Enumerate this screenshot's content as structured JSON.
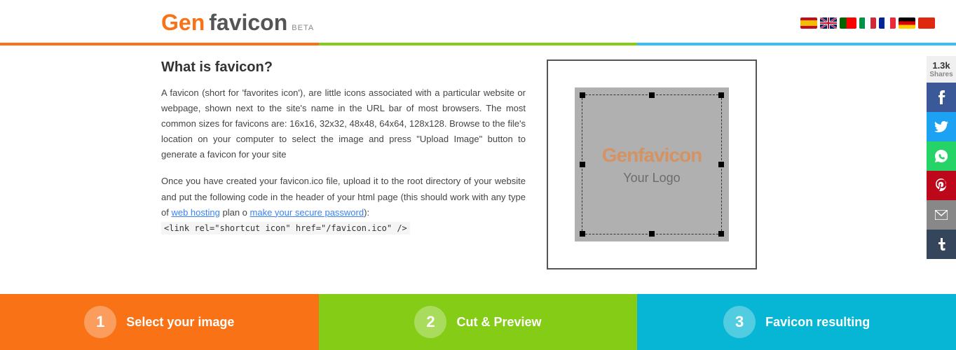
{
  "header": {
    "logo_gen": "Gen",
    "logo_favicon": "favicon",
    "logo_beta": "BETA",
    "title": "Genfavicon"
  },
  "languages": [
    {
      "name": "Spanish",
      "color": "#c60b1e",
      "code": "ES"
    },
    {
      "name": "English",
      "color": "#012169",
      "code": "EN"
    },
    {
      "name": "Portuguese",
      "color": "#006600",
      "code": "PT"
    },
    {
      "name": "Italian",
      "color": "#009246",
      "code": "IT"
    },
    {
      "name": "French",
      "color": "#002395",
      "code": "FR"
    },
    {
      "name": "German",
      "color": "#000000",
      "code": "DE"
    },
    {
      "name": "Chinese",
      "color": "#de2910",
      "code": "ZH"
    }
  ],
  "content": {
    "section_title": "What is favicon?",
    "description1": "A favicon (short for 'favorites icon'), are little icons associated with a particular website or webpage, shown next to the site's name in the URL bar of most browsers. The most common sizes for favicons are: 16x16, 32x32, 48x48, 64x64, 128x128. Browse to the file's location on your computer to select the image and press \"Upload Image\" button to generate a favicon for your site",
    "description2": "Once you have created your favicon.ico file, upload it to the root directory of your website and put the following code in the header of your html page (this should work with any type of",
    "link1": "web hosting",
    "link1_href": "#",
    "link2_text": "plan o",
    "link3": "make your secure password",
    "link3_href": "#",
    "colon": "):",
    "code": "<link rel=\"shortcut icon\" href=\"/favicon.ico\" />"
  },
  "preview": {
    "logo_text_gen": "Genfavicon",
    "logo_text_your": "Your Logo"
  },
  "steps": [
    {
      "number": "1",
      "label": "Select your image",
      "color": "#f97316"
    },
    {
      "number": "2",
      "label": "Cut & Preview",
      "color": "#84cc16"
    },
    {
      "number": "3",
      "label": "Favicon resulting",
      "color": "#06b6d4"
    }
  ],
  "social": {
    "count": "1.3k",
    "shares_label": "Shares",
    "buttons": [
      {
        "icon": "f",
        "label": "Facebook"
      },
      {
        "icon": "t",
        "label": "Twitter"
      },
      {
        "icon": "w",
        "label": "WhatsApp"
      },
      {
        "icon": "p",
        "label": "Pinterest"
      },
      {
        "icon": "@",
        "label": "Email"
      },
      {
        "icon": "t",
        "label": "Tumblr"
      }
    ]
  }
}
